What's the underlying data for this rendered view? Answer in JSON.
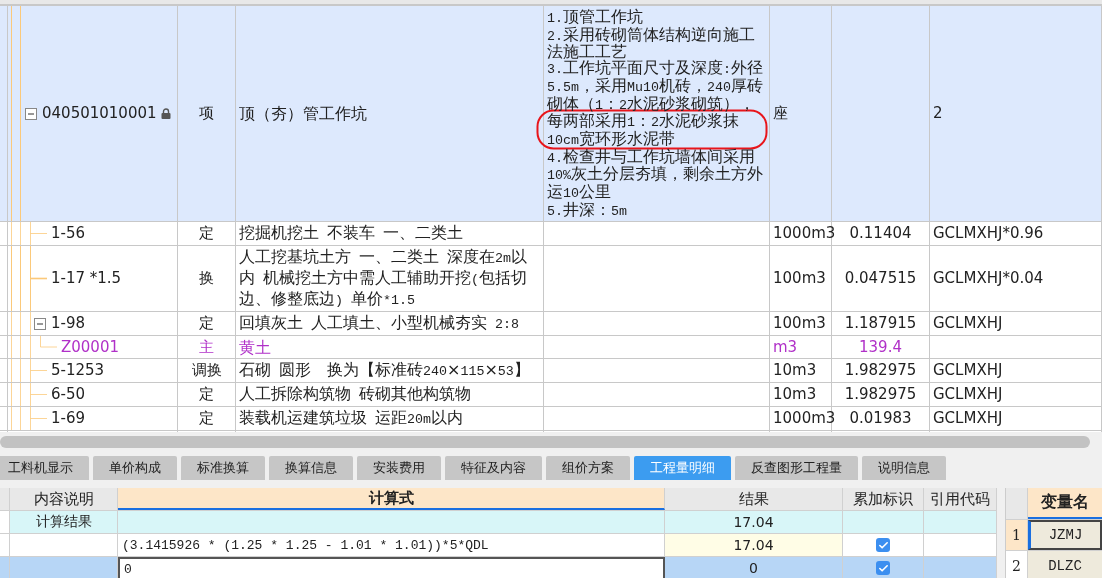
{
  "items": [
    {
      "code": "040501010001",
      "kind": "item",
      "type": "项",
      "name": "顶（夯）管工作坑",
      "features": "1.顶管工作坑\n2.采用砖砌筒体结构逆向施工法施工工艺\n3.工作坑平面尺寸及深度:外径5.5m，采用Mu10机砖，240厚砖砌体（1：2水泥砂浆砌筑），每两部采用1：2水泥砂浆抹10cm宽环形水泥带\n4.检查井与工作坑墙体间采用10%灰土分层夯填，剩余土方外运10公里\n5.井深：5m",
      "unit": "座",
      "expression": "2",
      "locked": true,
      "circled": true,
      "selected": true,
      "expanded": true,
      "children": [
        {
          "code": "1-56",
          "kind": "norm",
          "type": "定",
          "name": "挖掘机挖土 不装车 一、二类土",
          "unit": "1000m3",
          "quantity": "0.11404",
          "expression": "GCLMXHJ*0.96",
          "selected": false
        },
        {
          "code": "1-17 *1.5",
          "kind": "norm",
          "type": "换",
          "name": "人工挖基坑土方 一、二类土 深度在2m以内 机械挖土方中需人工辅助开挖(包括切边、修整底边) 单价*1.5",
          "unit": "100m3",
          "quantity": "0.047515",
          "expression": "GCLMXHJ*0.04",
          "selected": false
        },
        {
          "code": "1-98",
          "kind": "norm",
          "type": "定",
          "name": "回填灰土 人工填土、小型机械夯实 2:8",
          "unit": "100m3",
          "quantity": "1.187915",
          "expression": "GCLMXHJ",
          "selected": false,
          "expanded": true,
          "children": [
            {
              "code": "Z00001",
              "kind": "material",
              "type": "主",
              "name": "黄土",
              "unit": "m3",
              "quantity": "139.4",
              "selected": false
            }
          ]
        },
        {
          "code": "5-1253",
          "kind": "norm",
          "type": "调换",
          "name": "石砌 圆形　换为【标准砖240×115×53】",
          "unit": "10m3",
          "quantity": "1.982975",
          "expression": "GCLMXHJ",
          "selected": false
        },
        {
          "code": "6-50",
          "kind": "norm",
          "type": "定",
          "name": "人工拆除构筑物 砖砌其他构筑物",
          "unit": "10m3",
          "quantity": "1.982975",
          "expression": "GCLMXHJ",
          "selected": false
        },
        {
          "code": "1-69",
          "kind": "norm",
          "type": "定",
          "name": "装载机运建筑垃圾 运距20m以内",
          "unit": "1000m3",
          "quantity": "0.01983",
          "expression": "GCLMXHJ",
          "selected": false
        }
      ]
    }
  ],
  "tabs": [
    {
      "label": "工料机显示",
      "selected": false
    },
    {
      "label": "单价构成",
      "selected": false
    },
    {
      "label": "标准换算",
      "selected": false
    },
    {
      "label": "换算信息",
      "selected": false
    },
    {
      "label": "安装费用",
      "selected": false
    },
    {
      "label": "特征及内容",
      "selected": false
    },
    {
      "label": "组价方案",
      "selected": false
    },
    {
      "label": "工程量明细",
      "selected": true
    },
    {
      "label": "反查图形工程量",
      "selected": false
    },
    {
      "label": "说明信息",
      "selected": false
    }
  ],
  "detail": {
    "columns": [
      "内容说明",
      "计算式",
      "结果",
      "累加标识",
      "引用代码"
    ],
    "rows": [
      {
        "kind": "total",
        "description": "计算结果",
        "result": "17.04",
        "selected": false
      },
      {
        "kind": "line",
        "formula": "(3.1415926 * (1.25 * 1.25 - 1.01 * 1.01))*5*QDL",
        "result": "17.04",
        "checked": true,
        "selected": false
      },
      {
        "kind": "line",
        "formula": "0",
        "result": "0",
        "checked": true,
        "selected": true
      }
    ]
  },
  "variables": {
    "header": "变量名",
    "rows": [
      {
        "index": "1",
        "name": "JZMJ",
        "selected": true
      },
      {
        "index": "2",
        "name": "DLZC",
        "selected": false
      }
    ]
  }
}
